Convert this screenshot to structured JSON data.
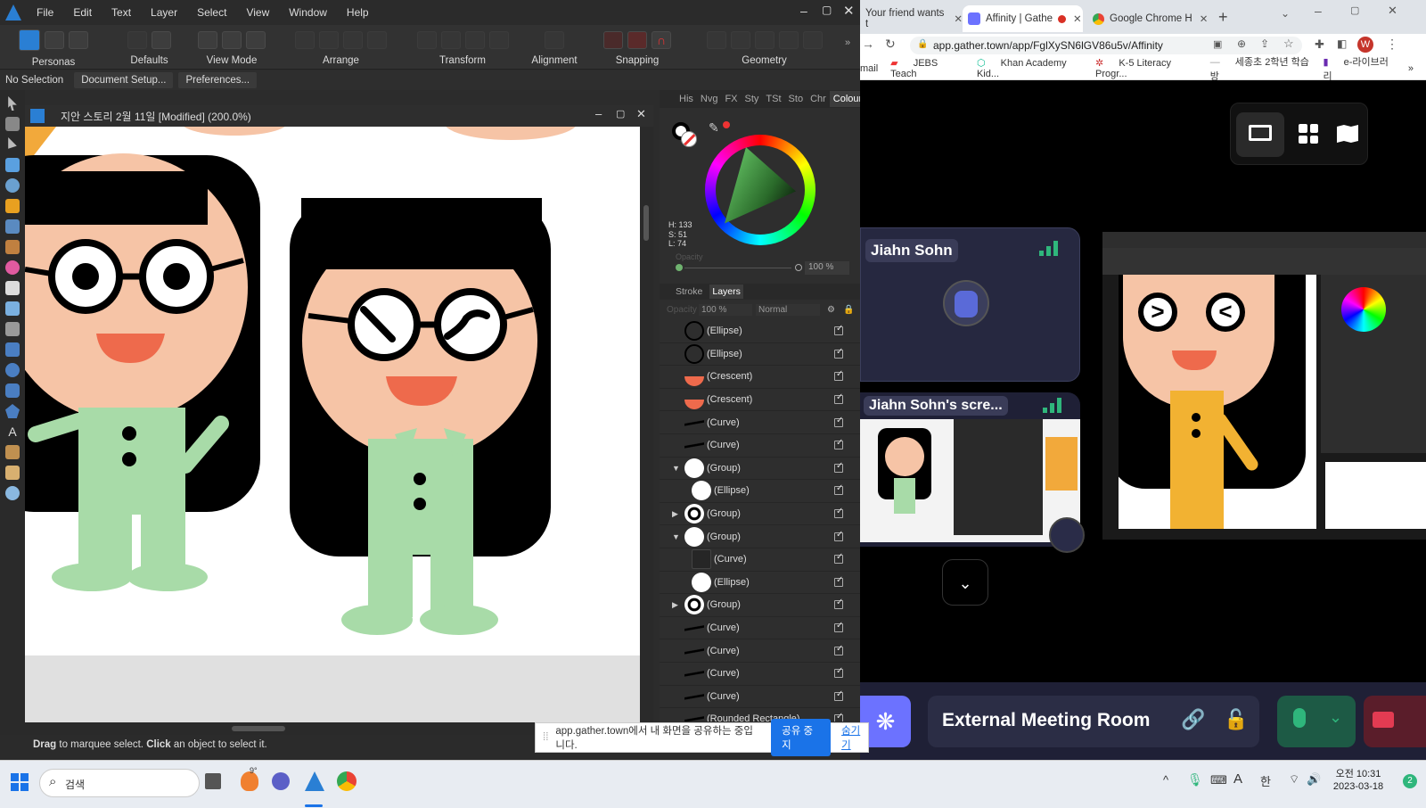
{
  "affinity": {
    "menu": [
      "File",
      "Edit",
      "Text",
      "Layer",
      "Select",
      "View",
      "Window",
      "Help"
    ],
    "toolbar": {
      "personas_label": "Personas",
      "defaults_label": "Defaults",
      "viewmode_label": "View Mode",
      "arrange_label": "Arrange",
      "transform_label": "Transform",
      "alignment_label": "Alignment",
      "snapping_label": "Snapping",
      "geometry_label": "Geometry"
    },
    "context": {
      "selection": "No Selection",
      "doc_setup": "Document Setup...",
      "preferences": "Preferences..."
    },
    "document_title": "지안 스토리 2월 11일 [Modified] (200.0%)",
    "status": {
      "drag": "Drag",
      "t1": " to marquee select. ",
      "click": "Click",
      "t2": " an object to select it."
    },
    "studio": {
      "top_tabs": [
        "His",
        "Nvg",
        "FX",
        "Sty",
        "TSt",
        "Sto",
        "Chr",
        "Colour"
      ],
      "hsl": {
        "h": "H: 133",
        "s": "S: 51",
        "l": "L: 74"
      },
      "opacity_label": "Opacity",
      "opacity_value": "100 %",
      "layer_tabs": [
        "Stroke",
        "Layers"
      ],
      "layer_opacity": "100 %",
      "blend_mode": "Normal",
      "layers": [
        {
          "name": "(Ellipse)",
          "thumb": "ring"
        },
        {
          "name": "(Ellipse)",
          "thumb": "ring"
        },
        {
          "name": "(Crescent)",
          "thumb": "crescent"
        },
        {
          "name": "(Crescent)",
          "thumb": "crescent"
        },
        {
          "name": "(Curve)",
          "thumb": "curve"
        },
        {
          "name": "(Curve)",
          "thumb": "curve"
        },
        {
          "name": "(Group)",
          "thumb": "white",
          "expand": "▼"
        },
        {
          "name": "(Ellipse)",
          "thumb": "white",
          "indent": true
        },
        {
          "name": "(Group)",
          "thumb": "eye",
          "expand": "▶"
        },
        {
          "name": "(Group)",
          "thumb": "white",
          "expand": "▼"
        },
        {
          "name": "(Curve)",
          "thumb": "dark",
          "indent": true
        },
        {
          "name": "(Ellipse)",
          "thumb": "white",
          "indent": true
        },
        {
          "name": "(Group)",
          "thumb": "eye",
          "expand": "▶"
        },
        {
          "name": "(Curve)",
          "thumb": "curve"
        },
        {
          "name": "(Curve)",
          "thumb": "curve"
        },
        {
          "name": "(Curve)",
          "thumb": "curve"
        },
        {
          "name": "(Curve)",
          "thumb": "curve"
        },
        {
          "name": "(Rounded Rectangle)",
          "thumb": "curve"
        }
      ]
    }
  },
  "browser": {
    "tabs": [
      {
        "title": "Your friend wants t"
      },
      {
        "title": "Affinity | Gathe"
      },
      {
        "title": "Google Chrome H"
      }
    ],
    "url": "app.gather.town/app/FglXySN6lGV86u5v/Affinity",
    "bookmarks": [
      "mail",
      "JEBS Teach",
      "Khan Academy Kid...",
      "K-5 Literacy Progr...",
      "세종초 2학년 학습방",
      "e-라이브러리"
    ],
    "profile_initial": "W",
    "participant_name": "Jiahn Sohn",
    "screen_label": "Jiahn Sohn's scre...",
    "room_name": "External Meeting Room"
  },
  "sharebar": {
    "message": "app.gather.town에서 내 화면을 공유하는 중입니다.",
    "stop_button": "공유 중지",
    "hide_link": "숨기기"
  },
  "taskbar": {
    "search_placeholder": "검색",
    "weather": "9°",
    "time": "오전 10:31",
    "date": "2023-03-18",
    "ime": "한",
    "notification_count": "2"
  },
  "colors": {
    "skin": "#f6c4a6",
    "hair": "#000000",
    "shirt": "#a8dba8",
    "mouth": "#ee6a4c",
    "gather_accent": "#6c72ff",
    "mic_green": "#2fb67c",
    "chrome_blue": "#1a73e8"
  }
}
